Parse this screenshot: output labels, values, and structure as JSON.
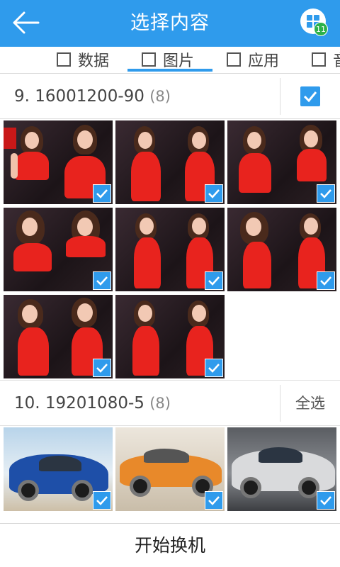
{
  "header": {
    "title": "选择内容",
    "badge_count": "11"
  },
  "tabs": [
    {
      "label": "数据",
      "checked": false
    },
    {
      "label": "图片",
      "checked": false,
      "active": true
    },
    {
      "label": "应用",
      "checked": false
    },
    {
      "label": "音",
      "checked": false
    }
  ],
  "sections": [
    {
      "name": "9. 16001200-90",
      "count": "(8)",
      "all_selected": true,
      "photos": 8,
      "selected": 8
    },
    {
      "name": "10. 19201080-5",
      "count": "(8)",
      "action_label": "全选",
      "photos": 8,
      "selected_visible": 3
    }
  ],
  "footer": {
    "start_label": "开始换机"
  },
  "colors": {
    "accent": "#2f9bec",
    "badge": "#2cb14a"
  }
}
